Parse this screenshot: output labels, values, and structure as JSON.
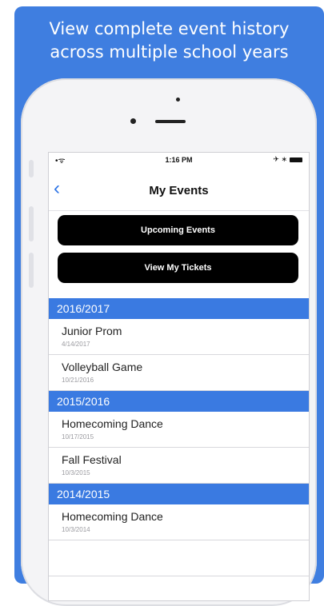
{
  "promo": {
    "line1": "View complete event history",
    "line2": "across multiple school years"
  },
  "status": {
    "time": "1:16 PM",
    "signal": "•ᯤ",
    "right": "✈ ∗"
  },
  "nav": {
    "back": "‹",
    "title": "My Events"
  },
  "buttons": {
    "upcoming": "Upcoming Events",
    "tickets": "View My Tickets"
  },
  "sections": [
    {
      "year": "2016/2017",
      "events": [
        {
          "name": "Junior Prom",
          "date": "4/14/2017"
        },
        {
          "name": "Volleyball Game",
          "date": "10/21/2016"
        }
      ]
    },
    {
      "year": "2015/2016",
      "events": [
        {
          "name": "Homecoming Dance",
          "date": "10/17/2015"
        },
        {
          "name": "Fall Festival",
          "date": "10/3/2015"
        }
      ]
    },
    {
      "year": "2014/2015",
      "events": [
        {
          "name": "Homecoming Dance",
          "date": "10/3/2014"
        }
      ]
    }
  ],
  "colors": {
    "brand_blue": "#3f7ee0",
    "section_blue": "#3a7ae1",
    "button_black": "#000000"
  }
}
